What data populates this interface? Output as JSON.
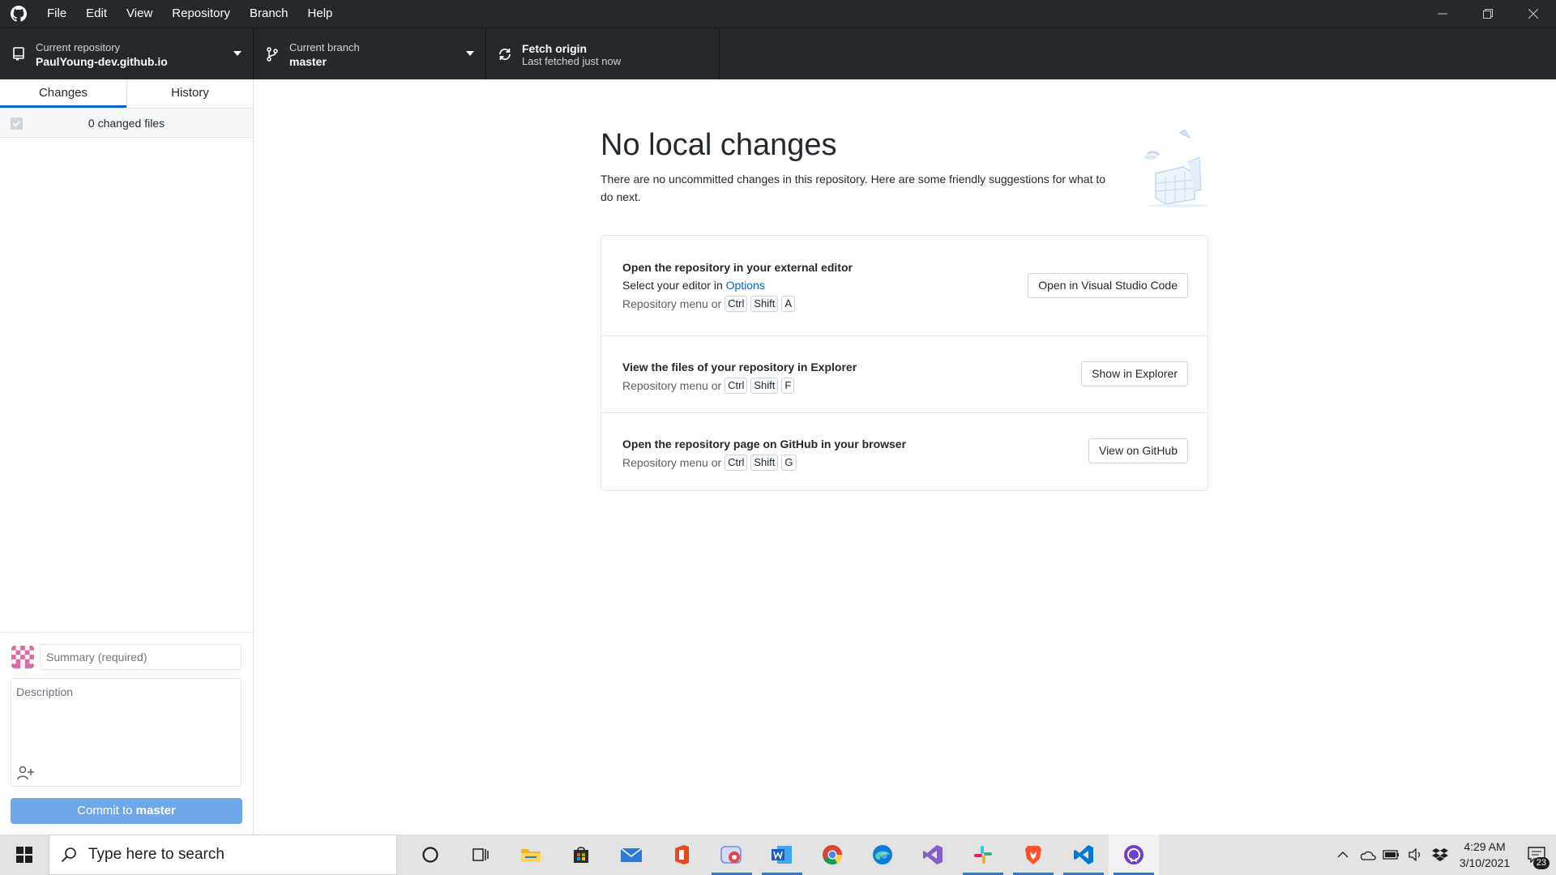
{
  "menu": [
    "File",
    "Edit",
    "View",
    "Repository",
    "Branch",
    "Help"
  ],
  "toolbar": {
    "repo_caption": "Current repository",
    "repo_name": "PaulYoung-dev.github.io",
    "branch_caption": "Current branch",
    "branch_name": "master",
    "fetch_title": "Fetch origin",
    "fetch_sub": "Last fetched just now"
  },
  "sidebar": {
    "tabs": [
      "Changes",
      "History"
    ],
    "active_tab": "Changes",
    "changed_files": "0 changed files",
    "summary_placeholder": "Summary (required)",
    "description_placeholder": "Description",
    "commit_prefix": "Commit to",
    "commit_branch": "master"
  },
  "main": {
    "title": "No local changes",
    "subtitle": "There are no uncommitted changes in this repository. Here are some friendly suggestions for what to do next.",
    "suggestions": [
      {
        "title": "Open the repository in your external editor",
        "desc_prefix": "Select your editor in",
        "desc_link": "Options",
        "shortcut_prefix": "Repository menu or",
        "keys": [
          "Ctrl",
          "Shift",
          "A"
        ],
        "button": "Open in Visual Studio Code"
      },
      {
        "title": "View the files of your repository in Explorer",
        "shortcut_prefix": "Repository menu or",
        "keys": [
          "Ctrl",
          "Shift",
          "F"
        ],
        "button": "Show in Explorer"
      },
      {
        "title": "Open the repository page on GitHub in your browser",
        "shortcut_prefix": "Repository menu or",
        "keys": [
          "Ctrl",
          "Shift",
          "G"
        ],
        "button": "View on GitHub"
      }
    ]
  },
  "taskbar": {
    "search_placeholder": "Type here to search",
    "apps": [
      "cortana-icon",
      "task-view-icon",
      "file-explorer-icon",
      "store-icon",
      "mail-icon",
      "office-icon",
      "discord-icon",
      "word-icon",
      "chrome-icon",
      "edge-icon",
      "visual-studio-icon",
      "slack-icon",
      "brave-icon",
      "vscode-icon",
      "github-desktop-icon"
    ],
    "time": "4:29 AM",
    "date": "3/10/2021",
    "notification_count": "23"
  },
  "colors": {
    "dark_chrome": "#24292e",
    "accent": "#0366d6",
    "commit_button": "#6fa8e8"
  }
}
